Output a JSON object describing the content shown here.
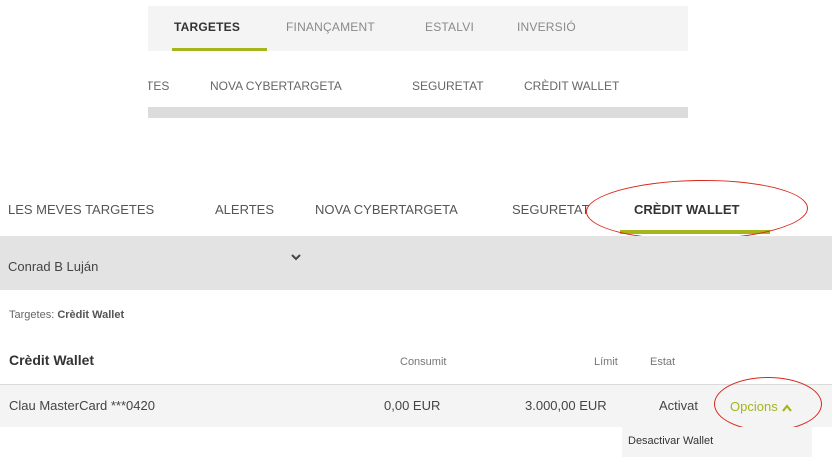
{
  "snippet": {
    "tabs": [
      "TARGETES",
      "FINANÇAMENT",
      "ESTALVI",
      "INVERSIÓ"
    ],
    "subtabs": [
      "TES",
      "NOVA CYBERTARGETA",
      "SEGURETAT",
      "CRÈDIT WALLET"
    ]
  },
  "nav": {
    "items": [
      "LES MEVES TARGETES",
      "ALERTES",
      "NOVA CYBERTARGETA",
      "SEGURETAT",
      "CRÈDIT WALLET"
    ],
    "active_index": 4
  },
  "user": {
    "name": "Conrad B Luján"
  },
  "breadcrumb": {
    "prefix": "Targetes:",
    "current": "Crèdit Wallet"
  },
  "table": {
    "title": "Crèdit Wallet",
    "columns": [
      "Consumit",
      "Límit",
      "Estat"
    ],
    "rows": [
      {
        "card": "Clau MasterCard ***0420",
        "consumit": "0,00 EUR",
        "limit": "3.000,00 EUR",
        "estat": "Activat"
      }
    ],
    "options_label": "Opcions"
  },
  "dropdown": {
    "items": [
      "Desactivar Wallet"
    ]
  },
  "colors": {
    "accent": "#a7b51d",
    "annotation": "#d9291c",
    "bar_gray": "#e3e3e3"
  }
}
